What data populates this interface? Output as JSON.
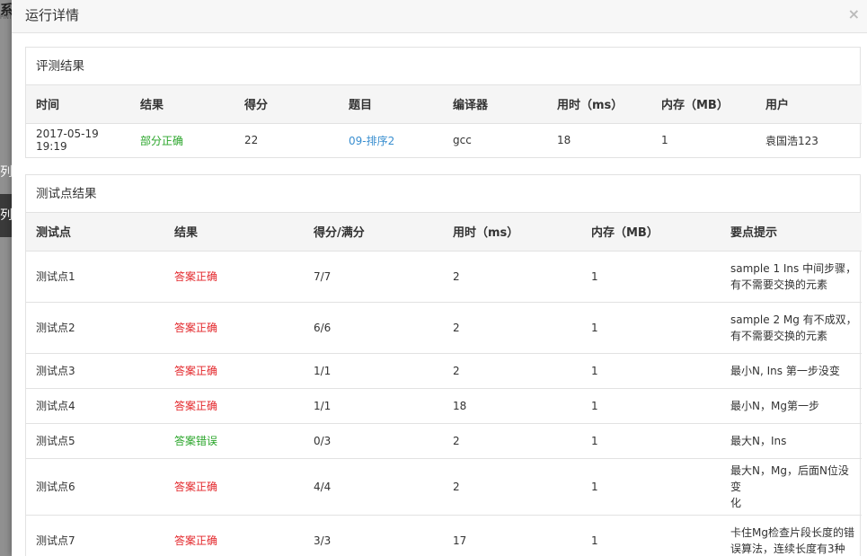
{
  "background": {
    "title_fragment": "系",
    "nav_item_1": "列",
    "nav_item_2": "列"
  },
  "modal": {
    "title": "运行详情",
    "close_glyph": "×"
  },
  "result_panel": {
    "heading": "评测结果",
    "columns": [
      "时间",
      "结果",
      "得分",
      "题目",
      "编译器",
      "用时（ms）",
      "内存（MB）",
      "用户"
    ],
    "row": {
      "time": "2017-05-19 19:19",
      "result": "部分正确",
      "score": "22",
      "problem": "09-排序2",
      "compiler": "gcc",
      "time_ms": "18",
      "memory_mb": "1",
      "user": "袁国浩123"
    }
  },
  "testcase_panel": {
    "heading": "测试点结果",
    "columns": [
      "测试点",
      "结果",
      "得分/满分",
      "用时（ms）",
      "内存（MB）",
      "要点提示"
    ],
    "rows": [
      {
        "name": "测试点1",
        "result": "答案正确",
        "status": "pass",
        "score": "7/7",
        "time": "2",
        "memory": "1",
        "hint_1": "sample 1 Ins 中间步骤，",
        "hint_2": "有不需要交换的元素"
      },
      {
        "name": "测试点2",
        "result": "答案正确",
        "status": "pass",
        "score": "6/6",
        "time": "2",
        "memory": "1",
        "hint_1": "sample 2 Mg 有不成双，",
        "hint_2": "有不需要交换的元素"
      },
      {
        "name": "测试点3",
        "result": "答案正确",
        "status": "pass",
        "score": "1/1",
        "time": "2",
        "memory": "1",
        "hint_1": "最小N, Ins 第一步没变",
        "hint_2": ""
      },
      {
        "name": "测试点4",
        "result": "答案正确",
        "status": "pass",
        "score": "1/1",
        "time": "18",
        "memory": "1",
        "hint_1": "最小N，Mg第一步",
        "hint_2": ""
      },
      {
        "name": "测试点5",
        "result": "答案错误",
        "status": "fail",
        "score": "0/3",
        "time": "2",
        "memory": "1",
        "hint_1": "最大N，Ins",
        "hint_2": ""
      },
      {
        "name": "测试点6",
        "result": "答案正确",
        "status": "pass",
        "score": "4/4",
        "time": "2",
        "memory": "1",
        "hint_1": "最大N，Mg，后面N位没变",
        "hint_2": "化"
      },
      {
        "name": "测试点7",
        "result": "答案正确",
        "status": "pass",
        "score": "3/3",
        "time": "17",
        "memory": "1",
        "hint_1": "卡住Mg检查片段长度的错",
        "hint_2": "误算法，连续长度有3种"
      }
    ]
  },
  "colors": {
    "pass_text": "#e3262a",
    "fail_text": "#2aa52a",
    "partial_text": "#2aa52a",
    "link": "#3a8fd0"
  }
}
